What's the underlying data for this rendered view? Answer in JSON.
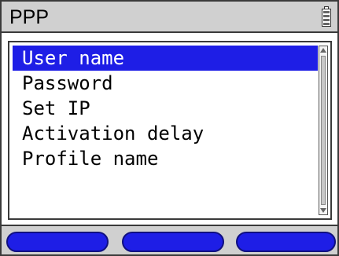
{
  "header": {
    "title": "PPP",
    "battery_icon": "battery-icon"
  },
  "menu": {
    "items": [
      {
        "label": "User name",
        "selected": true
      },
      {
        "label": "Password",
        "selected": false
      },
      {
        "label": "Set IP",
        "selected": false
      },
      {
        "label": "Activation delay",
        "selected": false
      },
      {
        "label": "Profile name",
        "selected": false
      }
    ]
  },
  "softkeys": [
    {
      "label": ""
    },
    {
      "label": ""
    },
    {
      "label": ""
    }
  ],
  "colors": {
    "selection": "#1e1ee6",
    "titlebar": "#d0d0d0",
    "softkey": "#1e1ee6"
  }
}
